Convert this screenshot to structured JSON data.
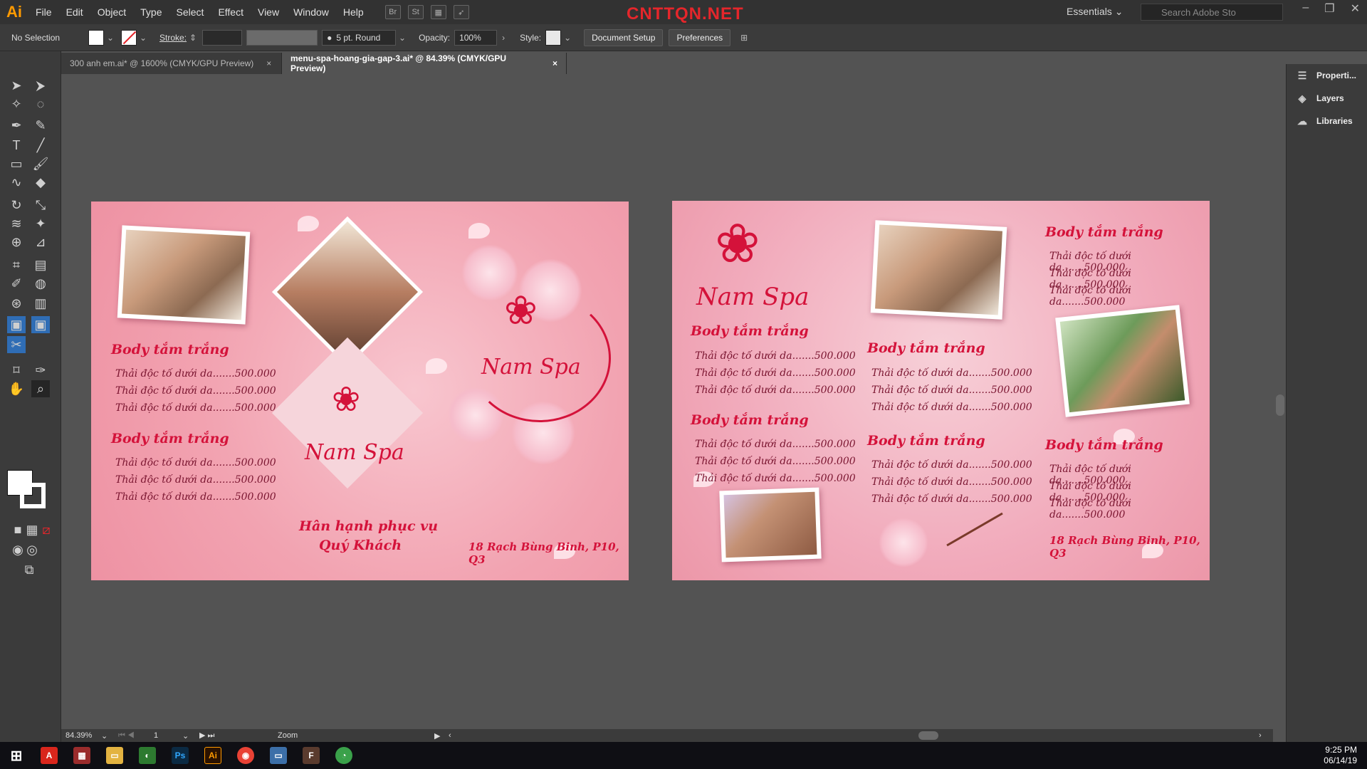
{
  "app": {
    "logo": "Ai",
    "watermark": "CNTTQN.NET",
    "menu": [
      "File",
      "Edit",
      "Object",
      "Type",
      "Select",
      "Effect",
      "View",
      "Window",
      "Help"
    ],
    "bridge": "Br",
    "stock": "St",
    "workspace": "Essentials",
    "search_placeholder": "Search Adobe Sto"
  },
  "control": {
    "selection": "No Selection",
    "stroke_label": "Stroke:",
    "brush": "5 pt. Round",
    "opacity_label": "Opacity:",
    "opacity_value": "100%",
    "style_label": "Style:",
    "document_setup": "Document Setup",
    "preferences": "Preferences"
  },
  "tabs": [
    {
      "label": "300 anh em.ai* @ 1600% (CMYK/GPU Preview)",
      "close": "×"
    },
    {
      "label": "menu-spa-hoang-gia-gap-3.ai* @ 84.39% (CMYK/GPU Preview)",
      "close": "×"
    }
  ],
  "panels": [
    {
      "label": "Properti...",
      "icon": "properties-icon"
    },
    {
      "label": "Layers",
      "icon": "layers-icon"
    },
    {
      "label": "Libraries",
      "icon": "libraries-icon"
    }
  ],
  "status": {
    "zoom": "84.39%",
    "artboard": "1",
    "mode": "Zoom"
  },
  "taskbar": {
    "time": "9:25 PM",
    "date": "06/14/19"
  },
  "menu_design": {
    "heading": "Body tắm trắng",
    "item_line": "Thải độc tố dưới da.......500.000",
    "brand": "Nam Spa",
    "welcome_1": "Hân hạnh phục vụ",
    "welcome_2": "Quý Khách",
    "address": "18 Rạch Bùng Binh, P10, Q3"
  },
  "colors": {
    "accent": "#d4123a",
    "panel": "#3b3b3b",
    "workspace": "#535353"
  }
}
